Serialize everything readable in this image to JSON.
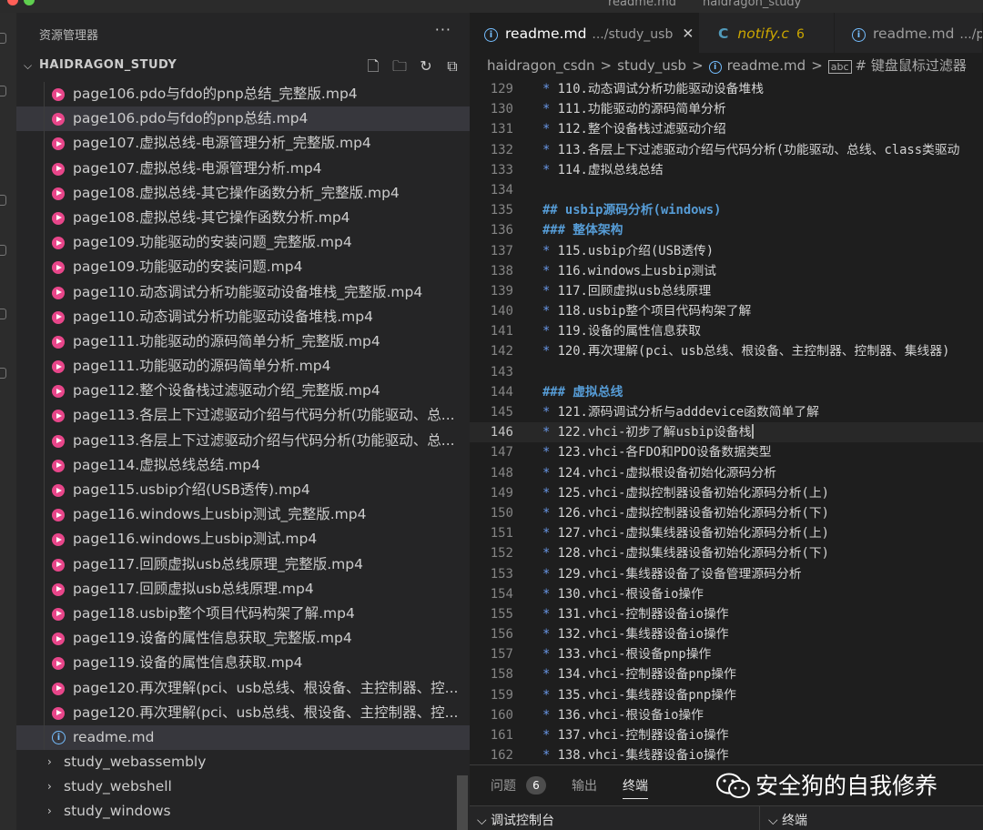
{
  "title_bar": {
    "text_left": "readme.md",
    "text_right": "haidragon_study"
  },
  "sidebar": {
    "title": "资源管理器",
    "more": "···",
    "section": "HAIDRAGON_STUDY",
    "files": [
      "page106.pdo与fdo的pnp总结_完整版.mp4",
      "page106.pdo与fdo的pnp总结.mp4",
      "page107.虚拟总线-电源管理分析_完整版.mp4",
      "page107.虚拟总线-电源管理分析.mp4",
      "page108.虚拟总线-其它操作函数分析_完整版.mp4",
      "page108.虚拟总线-其它操作函数分析.mp4",
      "page109.功能驱动的安装问题_完整版.mp4",
      "page109.功能驱动的安装问题.mp4",
      "page110.动态调试分析功能驱动设备堆栈_完整版.mp4",
      "page110.动态调试分析功能驱动设备堆栈.mp4",
      "page111.功能驱动的源码简单分析_完整版.mp4",
      "page111.功能驱动的源码简单分析.mp4",
      "page112.整个设备栈过滤驱动介绍_完整版.mp4",
      "page113.各层上下过滤驱动介绍与代码分析(功能驱动、总...",
      "page113.各层上下过滤驱动介绍与代码分析(功能驱动、总...",
      "page114.虚拟总线总结.mp4",
      "page115.usbip介绍(USB透传).mp4",
      "page116.windows上usbip测试_完整版.mp4",
      "page116.windows上usbip测试.mp4",
      "page117.回顾虚拟usb总线原理_完整版.mp4",
      "page117.回顾虚拟usb总线原理.mp4",
      "page118.usbip整个项目代码构架了解.mp4",
      "page119.设备的属性信息获取_完整版.mp4",
      "page119.设备的属性信息获取.mp4",
      "page120.再次理解(pci、usb总线、根设备、主控制器、控...",
      "page120.再次理解(pci、usb总线、根设备、主控制器、控...",
      "readme.md"
    ],
    "folders": [
      "study_webassembly",
      "study_webshell",
      "study_windows"
    ]
  },
  "tabs": [
    {
      "label": "readme.md",
      "path": ".../study_usb",
      "close": "✕"
    },
    {
      "label": "notify.c",
      "badge": "6",
      "icon": "C"
    },
    {
      "label": "readme.md",
      "path": ".../pa"
    }
  ],
  "breadcrumb": [
    "haidragon_csdn",
    "study_usb",
    "readme.md",
    "# 键盘鼠标过滤器"
  ],
  "code_lines": [
    {
      "n": "129",
      "t": "110.动态调试分析功能驱动设备堆栈",
      "k": "bullet"
    },
    {
      "n": "130",
      "t": "111.功能驱动的源码简单分析",
      "k": "bullet"
    },
    {
      "n": "131",
      "t": "112.整个设备栈过滤驱动介绍",
      "k": "bullet"
    },
    {
      "n": "132",
      "t": "113.各层上下过滤驱动介绍与代码分析(功能驱动、总线、class类驱动",
      "k": "bullet"
    },
    {
      "n": "133",
      "t": "114.虚拟总线总结",
      "k": "bullet"
    },
    {
      "n": "134",
      "t": "",
      "k": "blank"
    },
    {
      "n": "135",
      "t": "## usbip源码分析(windows)",
      "k": "heading"
    },
    {
      "n": "136",
      "t": "### 整体架构",
      "k": "heading"
    },
    {
      "n": "137",
      "t": "115.usbip介绍(USB透传)",
      "k": "bullet"
    },
    {
      "n": "138",
      "t": "116.windows上usbip测试",
      "k": "bullet"
    },
    {
      "n": "139",
      "t": "117.回顾虚拟usb总线原理",
      "k": "bullet"
    },
    {
      "n": "140",
      "t": "118.usbip整个项目代码构架了解",
      "k": "bullet"
    },
    {
      "n": "141",
      "t": "119.设备的属性信息获取",
      "k": "bullet"
    },
    {
      "n": "142",
      "t": "120.再次理解(pci、usb总线、根设备、主控制器、控制器、集线器)",
      "k": "bullet"
    },
    {
      "n": "143",
      "t": "",
      "k": "blank"
    },
    {
      "n": "144",
      "t": "### 虚拟总线",
      "k": "heading"
    },
    {
      "n": "145",
      "t": "121.源码调试分析与adddevice函数简单了解",
      "k": "bullet"
    },
    {
      "n": "146",
      "t": "122.vhci-初步了解usbip设备栈",
      "k": "current"
    },
    {
      "n": "147",
      "t": "123.vhci-各FDO和PDO设备数据类型",
      "k": "bullet"
    },
    {
      "n": "148",
      "t": "124.vhci-虚拟根设备初始化源码分析",
      "k": "bullet"
    },
    {
      "n": "149",
      "t": "125.vhci-虚拟控制器设备初始化源码分析(上)",
      "k": "bullet"
    },
    {
      "n": "150",
      "t": "126.vhci-虚拟控制器设备初始化源码分析(下)",
      "k": "bullet"
    },
    {
      "n": "151",
      "t": "127.vhci-虚拟集线器设备初始化源码分析(上)",
      "k": "bullet"
    },
    {
      "n": "152",
      "t": "128.vhci-虚拟集线器设备初始化源码分析(下)",
      "k": "bullet"
    },
    {
      "n": "153",
      "t": "129.vhci-集线器设备了设备管理源码分析",
      "k": "bullet"
    },
    {
      "n": "154",
      "t": "130.vhci-根设备io操作",
      "k": "bullet"
    },
    {
      "n": "155",
      "t": "131.vhci-控制器设备io操作",
      "k": "bullet"
    },
    {
      "n": "156",
      "t": "132.vhci-集线器设备io操作",
      "k": "bullet"
    },
    {
      "n": "157",
      "t": "133.vhci-根设备pnp操作",
      "k": "bullet"
    },
    {
      "n": "158",
      "t": "134.vhci-控制器设备pnp操作",
      "k": "bullet"
    },
    {
      "n": "159",
      "t": "135.vhci-集线器设备pnp操作",
      "k": "bullet"
    },
    {
      "n": "160",
      "t": "136.vhci-根设备io操作",
      "k": "bullet"
    },
    {
      "n": "161",
      "t": "137.vhci-控制器设备io操作",
      "k": "bullet"
    },
    {
      "n": "162",
      "t": "138.vhci-集线器设备io操作",
      "k": "bullet"
    }
  ],
  "panel": {
    "problems": "问题",
    "problems_count": "6",
    "output": "输出",
    "terminal": "终端",
    "debug_console": "调试控制台",
    "terminal2": "终端",
    "watermark": "安全狗的自我修养"
  }
}
